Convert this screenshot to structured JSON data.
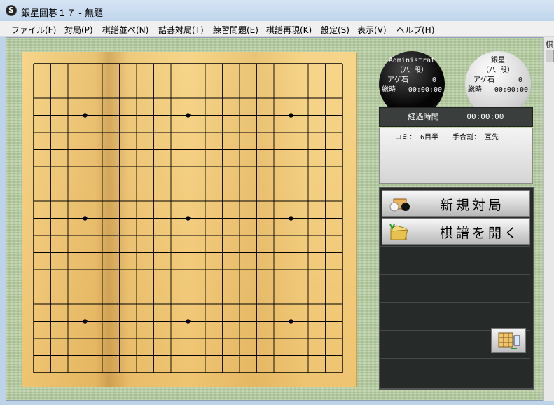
{
  "window": {
    "title": "銀星囲碁１７ - 無題",
    "app_icon": "go-stone-app-icon"
  },
  "menu": [
    {
      "label": "ファイル(F)"
    },
    {
      "label": "対局(P)"
    },
    {
      "label": "棋譜並べ(N)"
    },
    {
      "label": "詰碁対局(T)"
    },
    {
      "label": "練習問題(E)"
    },
    {
      "label": "棋譜再現(K)"
    },
    {
      "label": "設定(S)"
    },
    {
      "label": "表示(V)"
    },
    {
      "label": "ヘルプ(H)"
    }
  ],
  "board": {
    "size": 19,
    "star_points": [
      [
        3,
        3
      ],
      [
        3,
        9
      ],
      [
        3,
        15
      ],
      [
        9,
        3
      ],
      [
        9,
        9
      ],
      [
        9,
        15
      ],
      [
        15,
        3
      ],
      [
        15,
        9
      ],
      [
        15,
        15
      ]
    ]
  },
  "players": {
    "black": {
      "name": "Administrat",
      "rank": "（八 段）",
      "prisoners_label": "アゲ石",
      "prisoners": "0",
      "time_label": "総時",
      "time": "00:00:00"
    },
    "white": {
      "name": "銀星",
      "rank": "（八 段）",
      "prisoners_label": "アゲ石",
      "prisoners": "0",
      "time_label": "総時",
      "time": "00:00:00"
    }
  },
  "elapsed": {
    "label": "経過時間",
    "value": "00:00:00"
  },
  "game_info": {
    "text": "コミ： 6目半　　手合割： 互先"
  },
  "panel": {
    "new_game_label": "新規対局",
    "open_record_label": "棋譜を開く"
  },
  "side_strip": {
    "label": "棋"
  },
  "colors": {
    "board": "#f3cf80",
    "tatami": "#b7cfa2",
    "panel": "#262a29"
  }
}
